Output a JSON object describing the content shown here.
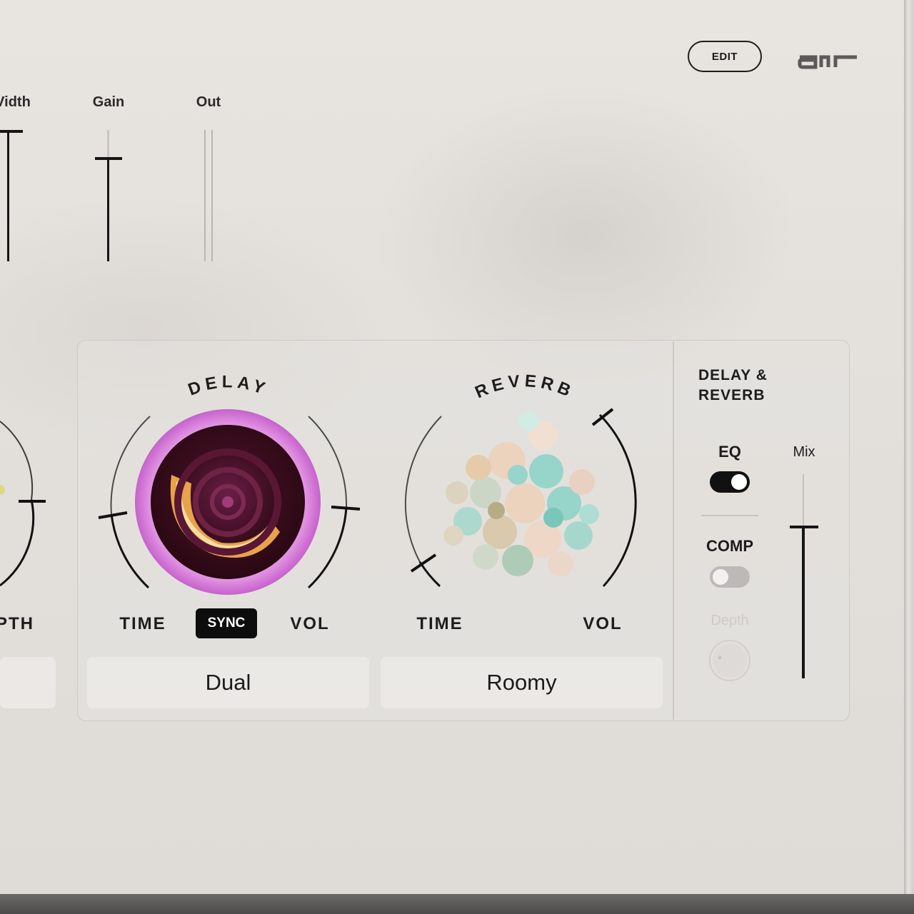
{
  "header": {
    "edit_label": "EDIT",
    "logo_name": "air-logo"
  },
  "faders": [
    {
      "label": "Width",
      "display_label": "Vidth",
      "level": 1.0
    },
    {
      "label": "Gain",
      "display_label": "Gain",
      "level": 0.78
    },
    {
      "label": "Out",
      "display_label": "Out",
      "level": 0.0
    }
  ],
  "left_partial": {
    "label": "PTH"
  },
  "delay": {
    "title": "DELAY",
    "time_label": "TIME",
    "sync_label": "SYNC",
    "vol_label": "VOL",
    "preset": "Dual",
    "colors": {
      "ring": "#d57ad8",
      "swirl": "#e8a24a"
    }
  },
  "reverb": {
    "title": "REVERB",
    "time_label": "TIME",
    "vol_label": "VOL",
    "preset": "Roomy",
    "colors": {
      "bubble_teal": "#8fd3c8",
      "bubble_peach": "#ecd2bb"
    }
  },
  "side": {
    "title_line1": "DELAY &",
    "title_line2": "REVERB",
    "eq_label": "EQ",
    "eq_on": true,
    "comp_label": "COMP",
    "comp_on": false,
    "depth_label": "Depth",
    "mix_label": "Mix",
    "mix_level": 0.75
  }
}
